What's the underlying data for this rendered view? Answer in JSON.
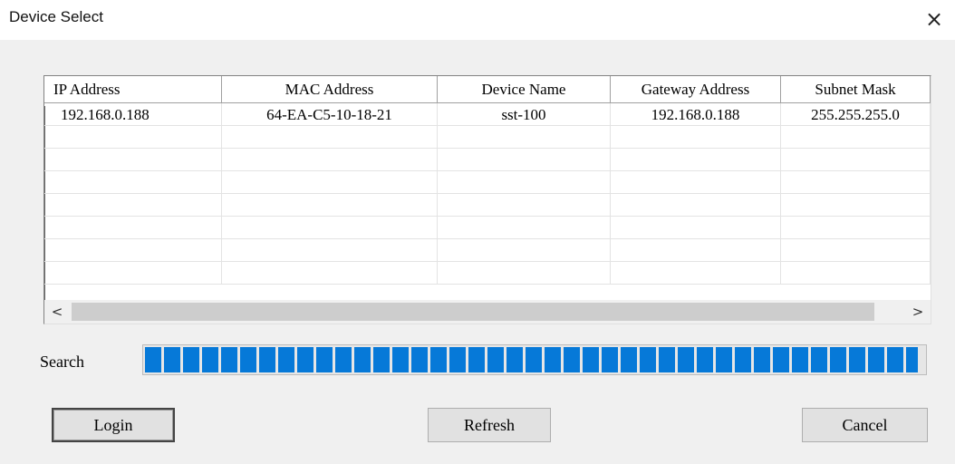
{
  "window": {
    "title": "Device Select",
    "close_label": "×"
  },
  "table": {
    "columns": [
      {
        "label": "IP Address",
        "width": 196,
        "align": "left"
      },
      {
        "label": "MAC Address",
        "width": 238,
        "align": "center"
      },
      {
        "label": "Device Name",
        "width": 191,
        "align": "center"
      },
      {
        "label": "Gateway Address",
        "width": 188,
        "align": "center"
      },
      {
        "label": "Subnet Mask",
        "width": 165,
        "align": "center"
      }
    ],
    "rows": [
      [
        "192.168.0.188",
        "64-EA-C5-10-18-21",
        "sst-100",
        "192.168.0.188",
        "255.255.255.0"
      ],
      [
        "",
        "",
        "",
        "",
        ""
      ],
      [
        "",
        "",
        "",
        "",
        ""
      ],
      [
        "",
        "",
        "",
        "",
        ""
      ],
      [
        "",
        "",
        "",
        "",
        ""
      ],
      [
        "",
        "",
        "",
        "",
        ""
      ],
      [
        "",
        "",
        "",
        "",
        ""
      ],
      [
        "",
        "",
        "",
        "",
        ""
      ]
    ],
    "scroll_left_icon": "chevron-left-icon",
    "scroll_right_icon": "chevron-right-icon",
    "scroll_left_glyph": "<",
    "scroll_right_glyph": ">"
  },
  "search": {
    "label": "Search",
    "progress": 0.99,
    "bar_color": "#0679d8"
  },
  "buttons": {
    "login": "Login",
    "refresh": "Refresh",
    "cancel": "Cancel"
  }
}
